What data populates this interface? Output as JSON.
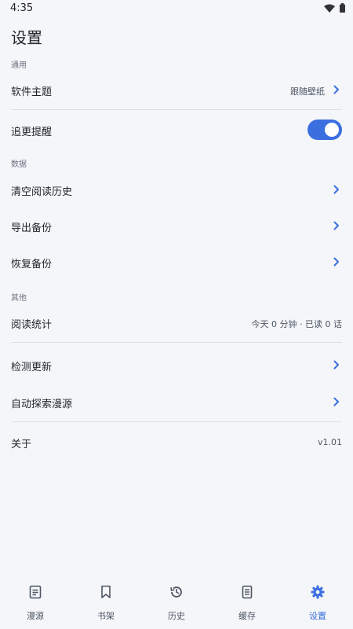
{
  "status": {
    "time": "4:35"
  },
  "page": {
    "title": "设置"
  },
  "sections": {
    "general": "通用",
    "data": "数据",
    "other": "其他"
  },
  "rows": {
    "theme": {
      "label": "软件主题",
      "value": "跟随壁纸"
    },
    "update_reminder": {
      "label": "追更提醒",
      "enabled": true
    },
    "clear_history": {
      "label": "清空阅读历史"
    },
    "export_backup": {
      "label": "导出备份"
    },
    "restore_backup": {
      "label": "恢复备份"
    },
    "reading_stats": {
      "label": "阅读统计",
      "value": "今天 0 分钟 · 已读 0 话"
    },
    "check_update": {
      "label": "检测更新"
    },
    "auto_explore": {
      "label": "自动探索漫源"
    },
    "about": {
      "label": "关于",
      "value": "v1.01"
    }
  },
  "nav": {
    "items": [
      {
        "label": "漫源",
        "icon": "source-icon"
      },
      {
        "label": "书架",
        "icon": "bookmark-icon"
      },
      {
        "label": "历史",
        "icon": "history-icon"
      },
      {
        "label": "缓存",
        "icon": "cache-icon"
      },
      {
        "label": "设置",
        "icon": "gear-icon"
      }
    ],
    "active": 4
  },
  "colors": {
    "accent": "#3b6fe0",
    "background": "#f5f6f9",
    "divider": "#dcdfe4"
  }
}
